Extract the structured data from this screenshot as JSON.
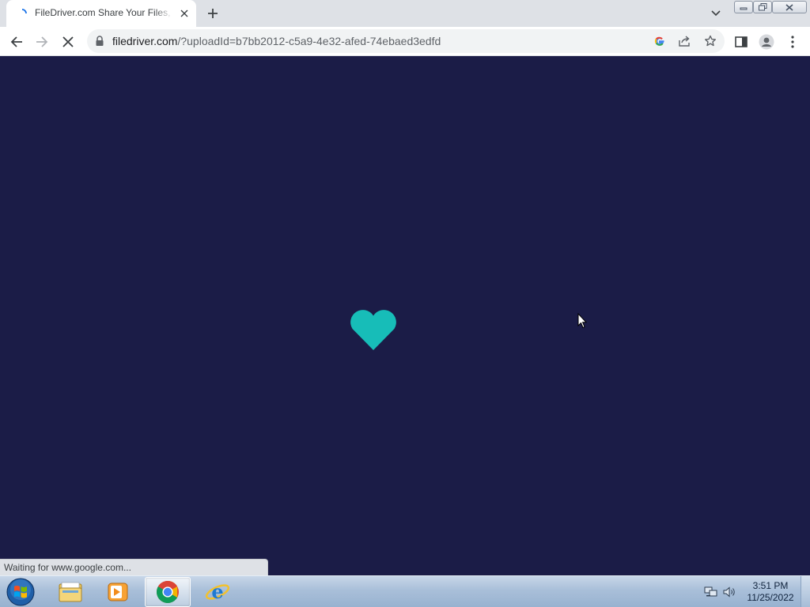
{
  "browser": {
    "tab": {
      "title": "FileDriver.com Share Your Files, Q"
    },
    "address_bar": {
      "host": "filedriver.com",
      "path": "/?uploadId=b7bb2012-c5a9-4e32-afed-74ebaed3edfd"
    },
    "status_bubble": "Waiting for www.google.com..."
  },
  "page": {
    "background_color": "#1b1c47",
    "loader": {
      "icon": "heart-icon",
      "color": "#17bdb8"
    }
  },
  "taskbar": {
    "time": "3:51 PM",
    "date": "11/25/2022",
    "pinned": [
      "start-orb",
      "windows-explorer",
      "windows-media-player",
      "google-chrome",
      "internet-explorer"
    ],
    "active_app": "google-chrome"
  }
}
